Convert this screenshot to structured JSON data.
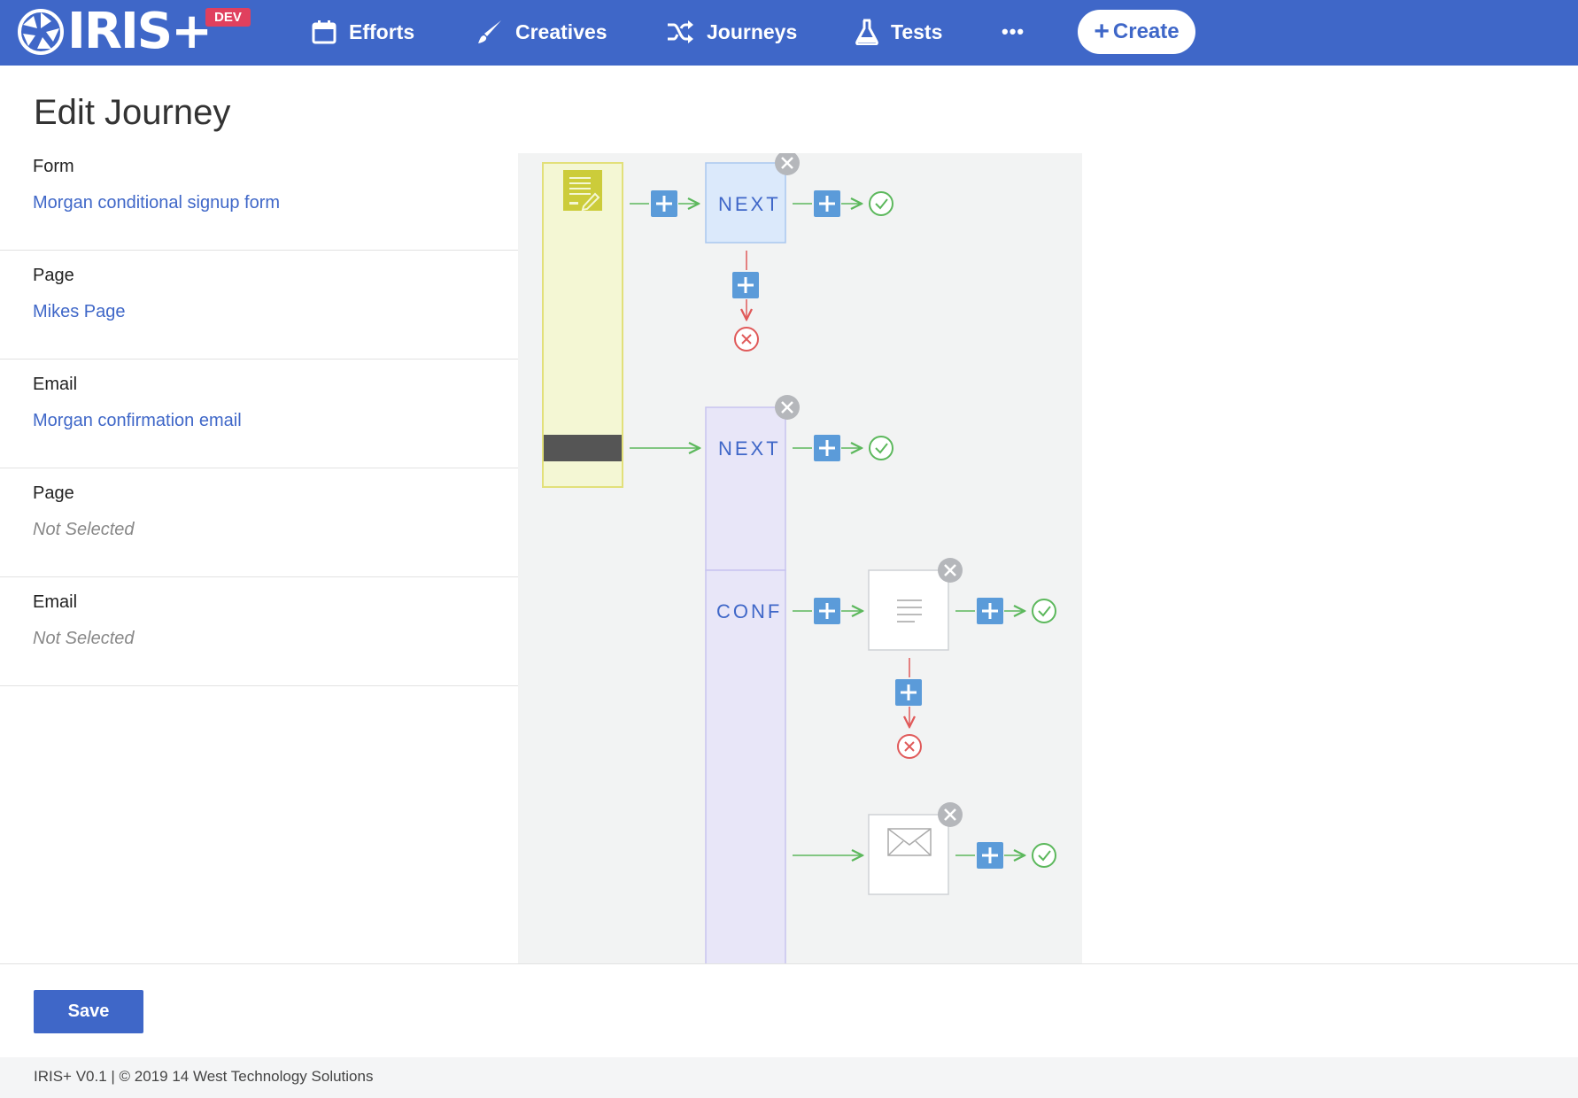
{
  "nav": {
    "brand": "IRIS+",
    "badge": "DEV",
    "items": [
      {
        "label": "Efforts",
        "icon": "calendar-icon"
      },
      {
        "label": "Creatives",
        "icon": "brush-icon"
      },
      {
        "label": "Journeys",
        "icon": "shuffle-icon"
      },
      {
        "label": "Tests",
        "icon": "flask-icon"
      }
    ],
    "more_label": "•••",
    "create_label": "Create"
  },
  "page": {
    "title": "Edit Journey"
  },
  "steps": [
    {
      "type": "Form",
      "value": "Morgan conditional signup form",
      "selected": true
    },
    {
      "type": "Page",
      "value": "Mikes Page",
      "selected": true
    },
    {
      "type": "Email",
      "value": "Morgan confirmation email",
      "selected": true
    },
    {
      "type": "Page",
      "value": "Not Selected",
      "selected": false
    },
    {
      "type": "Email",
      "value": "Not Selected",
      "selected": false
    }
  ],
  "canvas": {
    "nodes": {
      "next_1": "NEXT",
      "next_2": "NEXT",
      "conf": "CONF"
    }
  },
  "actions": {
    "save_label": "Save"
  },
  "footer": {
    "text": "IRIS+ V0.1 | © 2019 14 West Technology Solutions"
  },
  "colors": {
    "primary": "#3f67c8",
    "badge": "#e0405e",
    "success": "#5cb85c",
    "failure": "#e05a5a",
    "form_node": "#f4f7d4"
  }
}
